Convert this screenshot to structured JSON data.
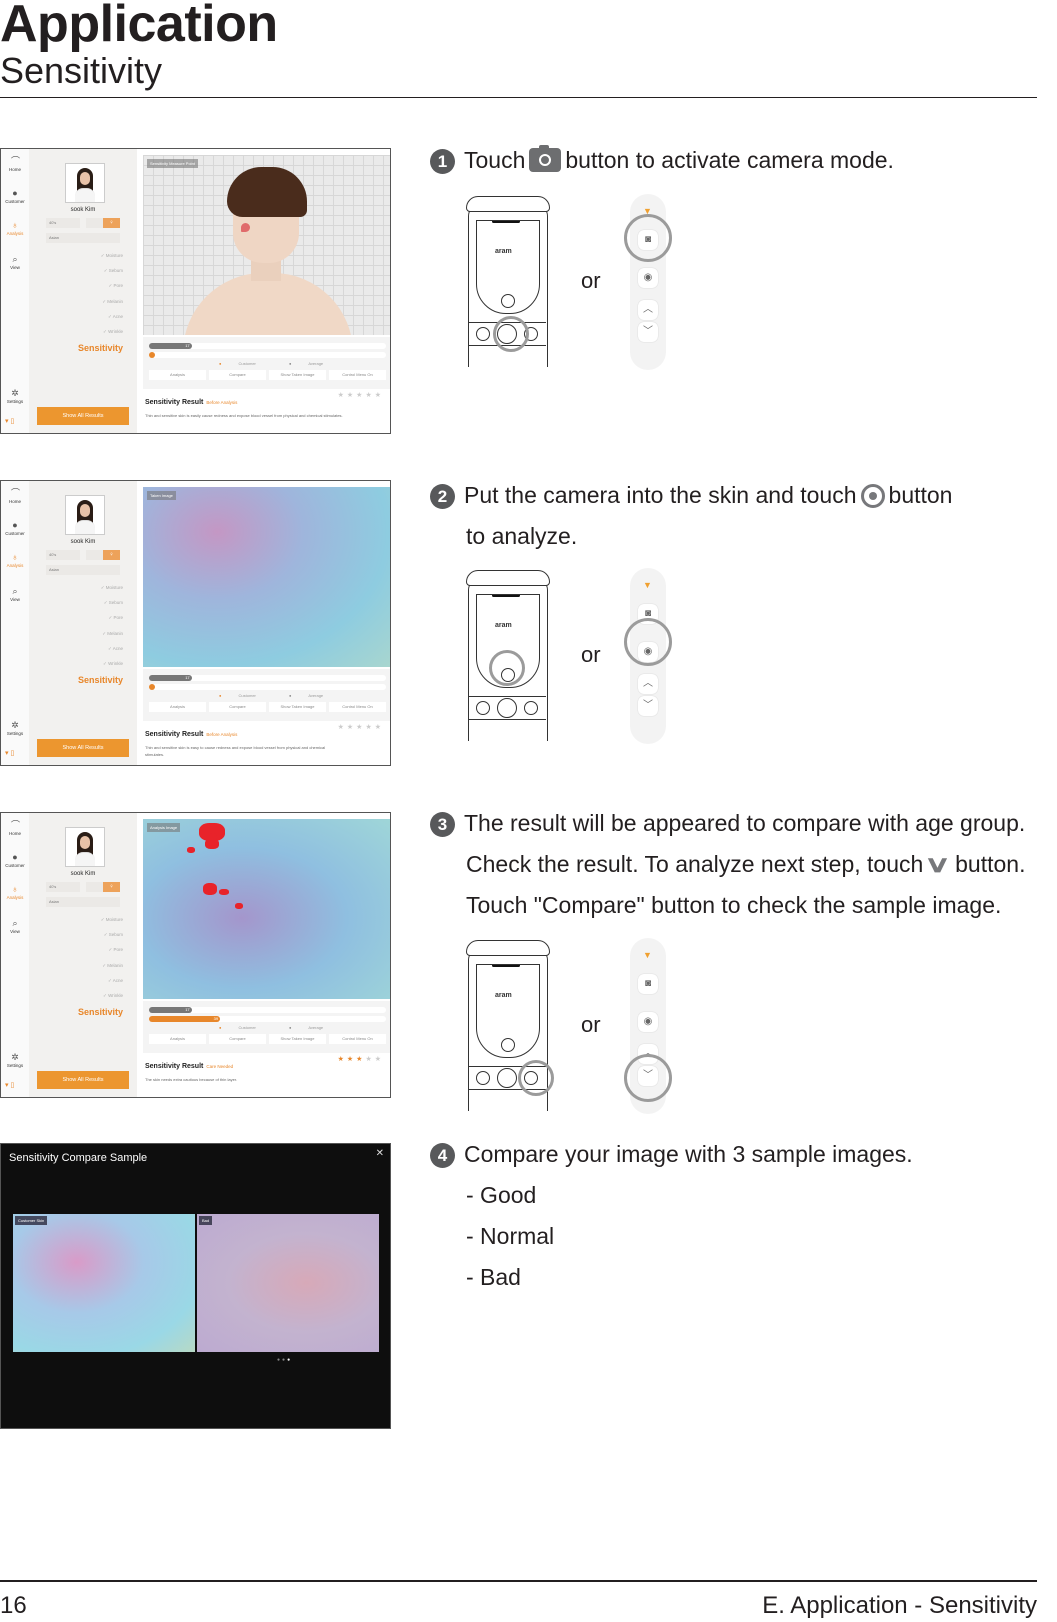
{
  "header": {
    "title": "Application",
    "subtitle": "Sensitivity"
  },
  "footer": {
    "page_number": "16",
    "section": "E. Application - Sensitivity"
  },
  "app": {
    "nav": [
      {
        "label": "Home",
        "icon": "aram-logo-icon"
      },
      {
        "label": "Customer",
        "icon": "person-icon"
      },
      {
        "label": "Analysis",
        "icon": "microscope-icon",
        "active": true
      },
      {
        "label": "View",
        "icon": "search-icon"
      },
      {
        "label": "Settings",
        "icon": "gear-icon"
      }
    ],
    "customer_name": "sook Kim",
    "age_group": "40's",
    "race": "Asian",
    "menu": [
      "Moisture",
      "Sebum",
      "Pore",
      "Melanin",
      "Acne",
      "Wrinkle"
    ],
    "menu_active": "Sensitivity",
    "show_all_label": "Show All Results",
    "legend": {
      "customer": "Customer",
      "average": "Average"
    },
    "buttons": [
      "Analysis",
      "Compare",
      "Show Taken Image",
      "Control Menu On"
    ],
    "result_title": "Sensitivity Result",
    "accent_color": "#e8872b"
  },
  "screenshots": [
    {
      "viewer_tag": "Sensitivity Measure Point",
      "average_value": "17",
      "average_fraction": 0.18,
      "customer_value": "",
      "customer_fraction": 0.0,
      "result_status": "Before Analysis",
      "result_text": "Thin and sensitive skin is easily cause redness and expose blood vessel from physical and chemical stimulates.",
      "stars_on": 0,
      "stars_total": 5
    },
    {
      "viewer_tag": "Taken Image",
      "average_value": "17",
      "average_fraction": 0.18,
      "customer_value": "",
      "customer_fraction": 0.0,
      "result_status": "Before Analysis",
      "result_text": "Thin and sensitive skin is easy to cause redness and expose blood vessel from physical and chemical stimulates.",
      "stars_on": 0,
      "stars_total": 5
    },
    {
      "viewer_tag": "Analysis Image",
      "average_value": "17",
      "average_fraction": 0.18,
      "customer_value": "39",
      "customer_fraction": 0.3,
      "result_status": "Care Needed",
      "result_text": "The skin needs extra cautious because of thin layer.",
      "stars_on": 3,
      "stars_total": 5
    }
  ],
  "compare_modal": {
    "title": "Sensitivity Compare Sample",
    "left_tag": "Customer Skin",
    "right_tag": "Bad",
    "page_count": 3,
    "page_active": 3
  },
  "steps": [
    {
      "number": "1",
      "text_before": "Touch",
      "icon": "camera-icon",
      "text_after": "button to activate camera mode."
    },
    {
      "number": "2",
      "text_before": "Put the camera into the skin and touch",
      "icon": "capture-dot-icon",
      "text_after": "button",
      "line2": "to analyze."
    },
    {
      "number": "3",
      "line1": "The result will be appeared to compare with age group.",
      "line2_before": "Check the result. To analyze next step, touch",
      "icon": "chevron-down-icon",
      "line2_after": "button.",
      "line3": "Touch \"Compare\" button to check the sample image."
    },
    {
      "number": "4",
      "line1": "Compare your image with 3 sample images.",
      "items": [
        "- Good",
        "- Normal",
        "- Bad"
      ]
    }
  ],
  "device": {
    "brand": "aram",
    "or_label": "or"
  }
}
